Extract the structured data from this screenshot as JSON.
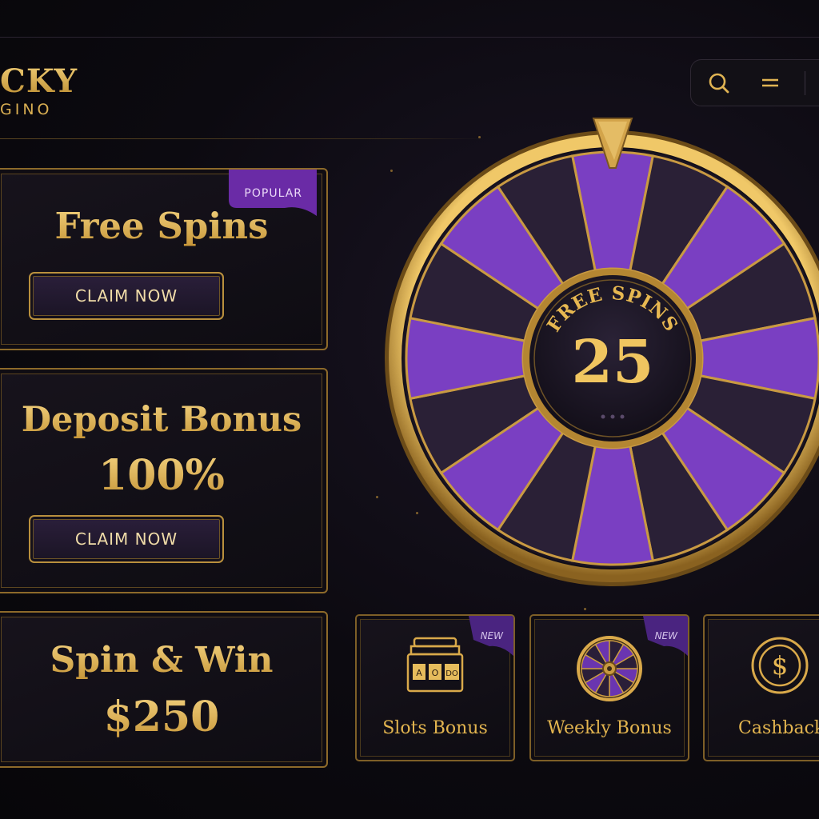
{
  "brand": {
    "name": "CKY",
    "subtitle": "GINO"
  },
  "header": {
    "icons": [
      "search-icon",
      "menu-icon"
    ]
  },
  "offers": [
    {
      "title": "Free Spins",
      "badge": "POPULAR",
      "button": "CLAIM NOW"
    },
    {
      "title": "Deposit Bonus",
      "value": "100%",
      "button": "CLAIM NOW"
    },
    {
      "title": "Spin & Win",
      "value": "$250"
    }
  ],
  "wheel": {
    "center_label": "FREE SPINS",
    "center_value": "25",
    "segment_colors": [
      "#7a3fc2",
      "#2a2036"
    ],
    "pointer_icon": "pointer-icon"
  },
  "tiles": [
    {
      "label": "Slots Bonus",
      "badge": "NEW",
      "icon": "slot-machine-icon",
      "slot_reels": [
        "A",
        "O",
        "DO"
      ]
    },
    {
      "label": "Weekly Bonus",
      "badge": "NEW",
      "icon": "wheel-icon"
    },
    {
      "label": "Cashback",
      "icon": "dollar-coin-icon"
    }
  ],
  "colors": {
    "gold": "#e6b652",
    "purple": "#7a3fc2",
    "background": "#0c0a10"
  }
}
